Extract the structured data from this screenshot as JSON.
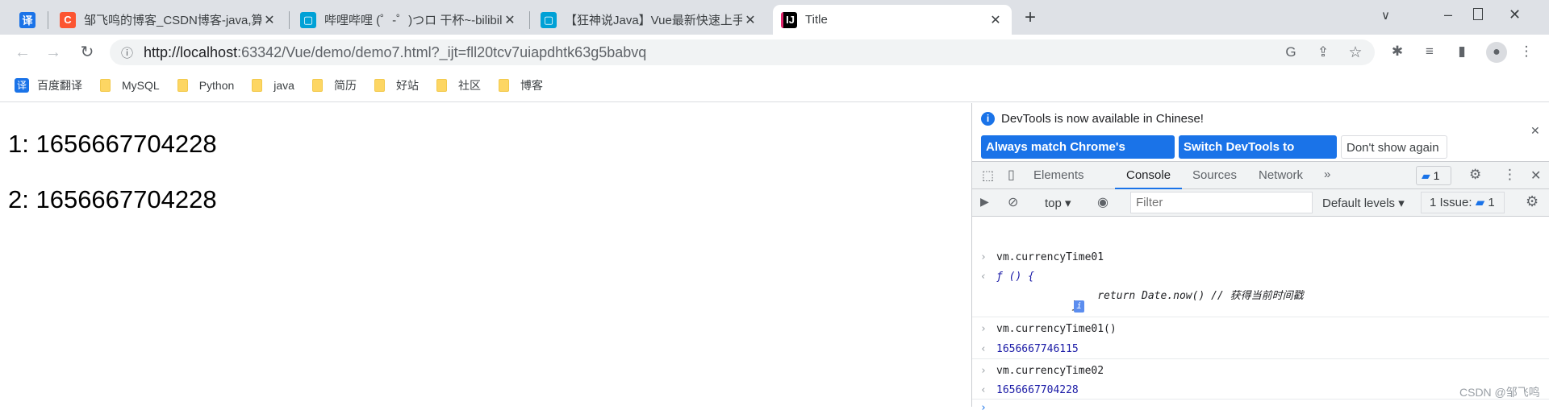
{
  "browser": {
    "tabs": [
      {
        "title": "",
        "icon": "translate-icon",
        "color": "#1a73e8"
      },
      {
        "title": "邹飞鸣的博客_CSDN博客-java,算",
        "icon": "csdn-icon",
        "color": "#fc5531"
      },
      {
        "title": "哔哩哔哩 (゜-゜)つロ 干杯~-bilibili",
        "icon": "bilibili-icon",
        "color": "#00a1d6"
      },
      {
        "title": "【狂神说Java】Vue最新快速上手",
        "icon": "bilibili-icon",
        "color": "#00a1d6"
      },
      {
        "title": "Title",
        "icon": "intellij-icon",
        "active": true
      }
    ],
    "url_host": "http://localhost",
    "url_rest": ":63342/Vue/demo/demo7.html?_ijt=fll20tcv7uiapdhtk63g5babvq",
    "bookmarks": [
      "百度翻译",
      "MySQL",
      "Python",
      "java",
      "简历",
      "好站",
      "社区",
      "博客"
    ]
  },
  "page": {
    "lines": [
      "1: 1656667704228",
      "2: 1656667704228"
    ]
  },
  "devtools": {
    "info_text": "DevTools is now available in Chinese!",
    "btn_match": "Always match Chrome's language",
    "btn_switch": "Switch DevTools to Chinese",
    "btn_dont": "Don't show again",
    "tabs": [
      "Elements",
      "Console",
      "Sources",
      "Network"
    ],
    "active_tab": "Console",
    "issue_count": "1",
    "context": "top",
    "filter_placeholder": "Filter",
    "levels": "Default levels",
    "issues_label": "1 Issue:",
    "issues_count": "1",
    "console": [
      {
        "type": "input",
        "text": "vm.currencyTime01"
      },
      {
        "type": "output",
        "text": "ƒ () {"
      },
      {
        "type": "cont",
        "text": "                return Date.now() // 获得当前时间戳"
      },
      {
        "type": "cont",
        "text": "            }"
      },
      {
        "type": "input",
        "text": "vm.currencyTime01()"
      },
      {
        "type": "output-num",
        "text": "1656667746115"
      },
      {
        "type": "input",
        "text": "vm.currencyTime02"
      },
      {
        "type": "output-num",
        "text": "1656667704228"
      }
    ],
    "watermark": "CSDN @邹飞鸣",
    "accent": "#1a73e8"
  }
}
